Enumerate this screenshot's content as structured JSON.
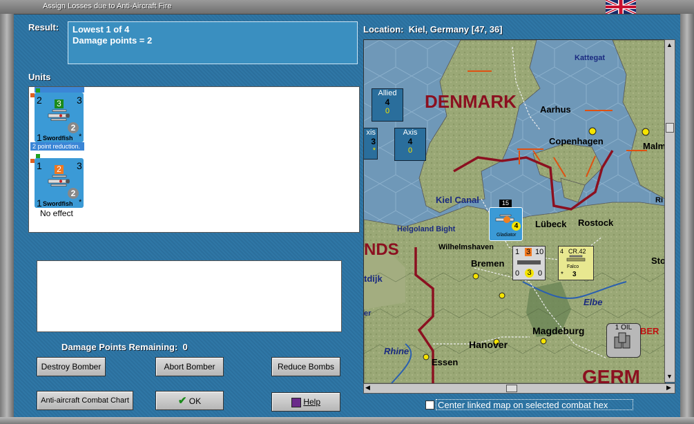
{
  "window": {
    "title": "Assign Losses due to Anti-Aircraft Fire"
  },
  "result": {
    "label": "Result:",
    "line1": "Lowest 1 of 4",
    "line2": "Damage points = 2"
  },
  "location": {
    "label": "Location:",
    "value": "Kiel, Germany [47, 36]"
  },
  "units": {
    "label": "Units",
    "items": [
      {
        "name": "Swordfish",
        "top_left": "2",
        "top_mid": "3",
        "top_right": "3",
        "circle": "2",
        "bottom_left": "1",
        "note": "2 point reduction.",
        "mid_color": "#1a8a1a"
      },
      {
        "name": "Swordfish",
        "top_left": "1",
        "top_mid": "2",
        "top_right": "3",
        "circle": "2",
        "bottom_left": "1",
        "note": "No effect",
        "mid_color": "#f07820"
      }
    ]
  },
  "damage_remaining": {
    "label": "Damage Points Remaining:",
    "value": "0"
  },
  "buttons": {
    "destroy_bomber": "Destroy Bomber",
    "abort_bomber": "Abort Bomber",
    "reduce_bombs": "Reduce Bombs",
    "aa_chart": "Anti-aircraft Combat Chart",
    "ok": "OK",
    "help": "Help"
  },
  "center_map": {
    "label": "Center linked map on selected combat hex",
    "checked": false
  },
  "map": {
    "labels": {
      "denmark": "DENMARK",
      "kattegat": "Kattegat",
      "aarhus": "Aarhus",
      "copenhagen": "Copenhagen",
      "malmo": "Malm",
      "kiel_canal": "Kiel Canal",
      "helgoland": "Helgoland Bight",
      "lubeck": "Lübeck",
      "rostock": "Rostock",
      "wilhelmshaven": "Wilhelmshaven",
      "bremen": "Bremen",
      "elbe": "Elbe",
      "magdeburg": "Magdeburg",
      "hanover": "Hanover",
      "essen": "Essen",
      "rhine": "Rhine",
      "nds": "NDS",
      "tdijk": "tdijk",
      "germ": "GERM",
      "ber": "BER",
      "sto": "Sto",
      "ri": "Ri",
      "er": "er",
      "oil": "1 OIL"
    },
    "allied": {
      "label": "Allied",
      "value": "4",
      "sub": "0"
    },
    "axis": {
      "label": "Axis",
      "value": "4",
      "sub": "0"
    },
    "axis_partial": {
      "label": "xis",
      "value": "3",
      "sub": "*"
    },
    "kiel_unit": {
      "name": "Gladiator",
      "number": "15",
      "circle": "4"
    },
    "cr42_unit": {
      "name": "Falco",
      "top": "CR.42",
      "left": "4",
      "val": "3",
      "star": "*"
    },
    "ship_unit": {
      "a": "1",
      "b": "3",
      "c": "10",
      "d": "0",
      "e": "3",
      "f": "0"
    }
  }
}
